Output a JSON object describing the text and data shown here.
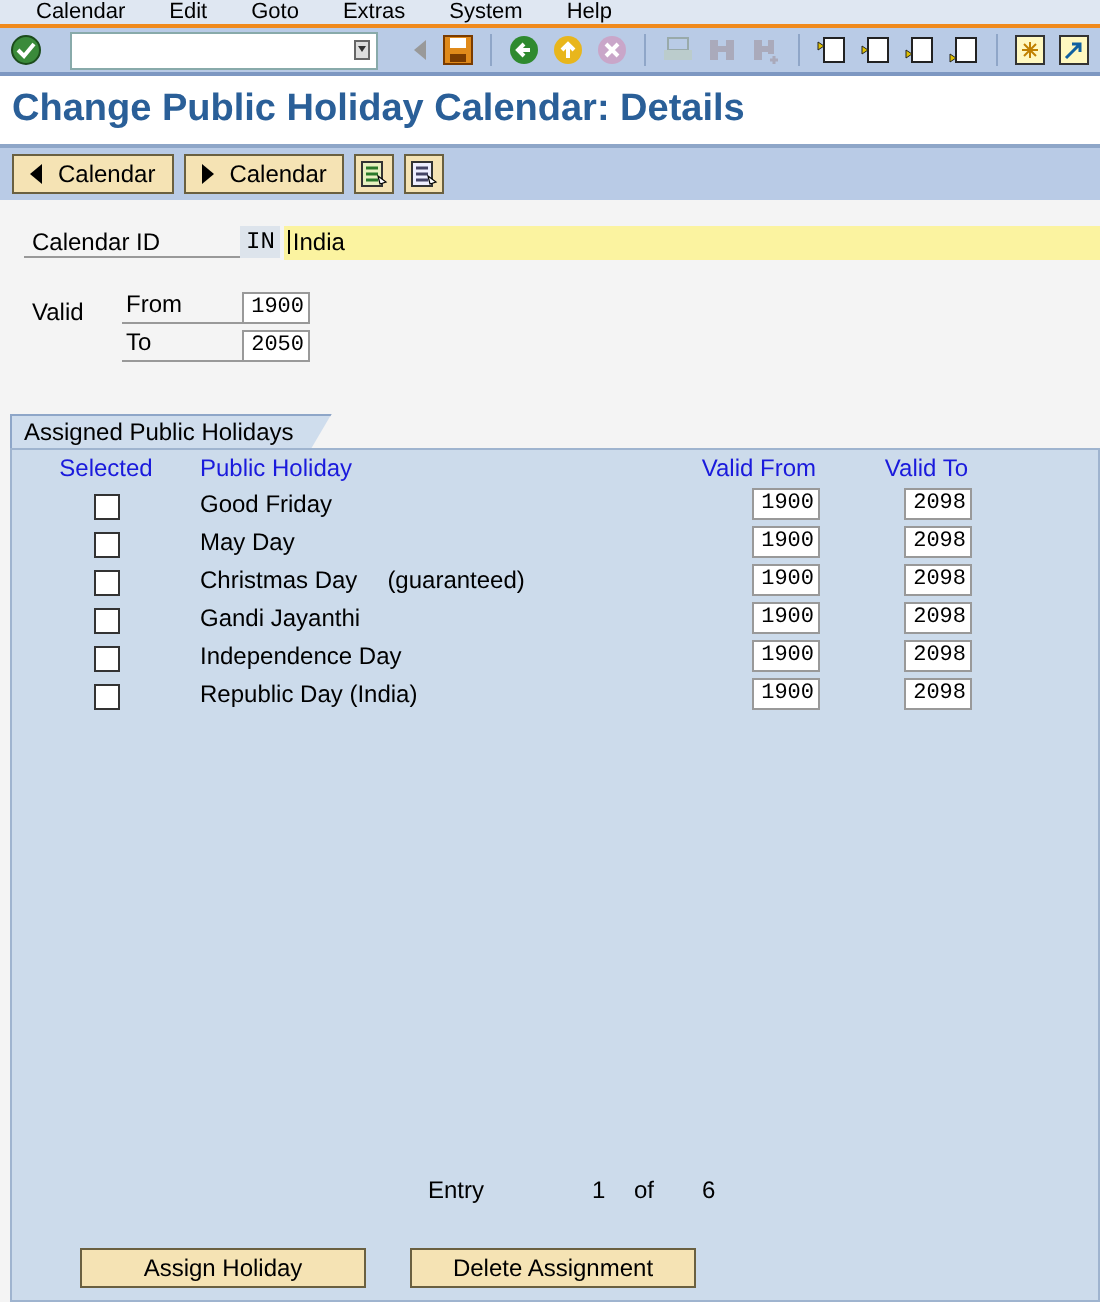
{
  "menu": [
    "Calendar",
    "Edit",
    "Goto",
    "Extras",
    "System",
    "Help"
  ],
  "title": "Change Public Holiday Calendar: Details",
  "app_toolbar": [
    {
      "label": "Calendar",
      "kind": "back"
    },
    {
      "label": "Calendar",
      "kind": "forward"
    }
  ],
  "calendar_id": {
    "label": "Calendar ID",
    "code": "IN",
    "value": "India"
  },
  "valid": {
    "label": "Valid",
    "from_label": "From",
    "from": "1900",
    "to_label": "To",
    "to": "2050"
  },
  "section": {
    "title": "Assigned Public Holidays",
    "columns": [
      "Selected",
      "Public Holiday",
      "Valid From",
      "Valid To"
    ],
    "rows": [
      {
        "checked": false,
        "name": "Good Friday",
        "from": "1900",
        "to": "2098"
      },
      {
        "checked": false,
        "name": "May Day",
        "from": "1900",
        "to": "2098"
      },
      {
        "checked": false,
        "name": "Christmas Day",
        "note": "(guaranteed)",
        "from": "1900",
        "to": "2098"
      },
      {
        "checked": false,
        "name": "Gandi Jayanthi",
        "from": "1900",
        "to": "2098"
      },
      {
        "checked": false,
        "name": "Independence Day",
        "from": "1900",
        "to": "2098"
      },
      {
        "checked": false,
        "name": "Republic Day (India)",
        "from": "1900",
        "to": "2098"
      }
    ],
    "entry": {
      "label": "Entry",
      "current": "1",
      "of": "of",
      "total": "6"
    }
  },
  "buttons": [
    "Assign Holiday",
    "Delete Assignment"
  ]
}
